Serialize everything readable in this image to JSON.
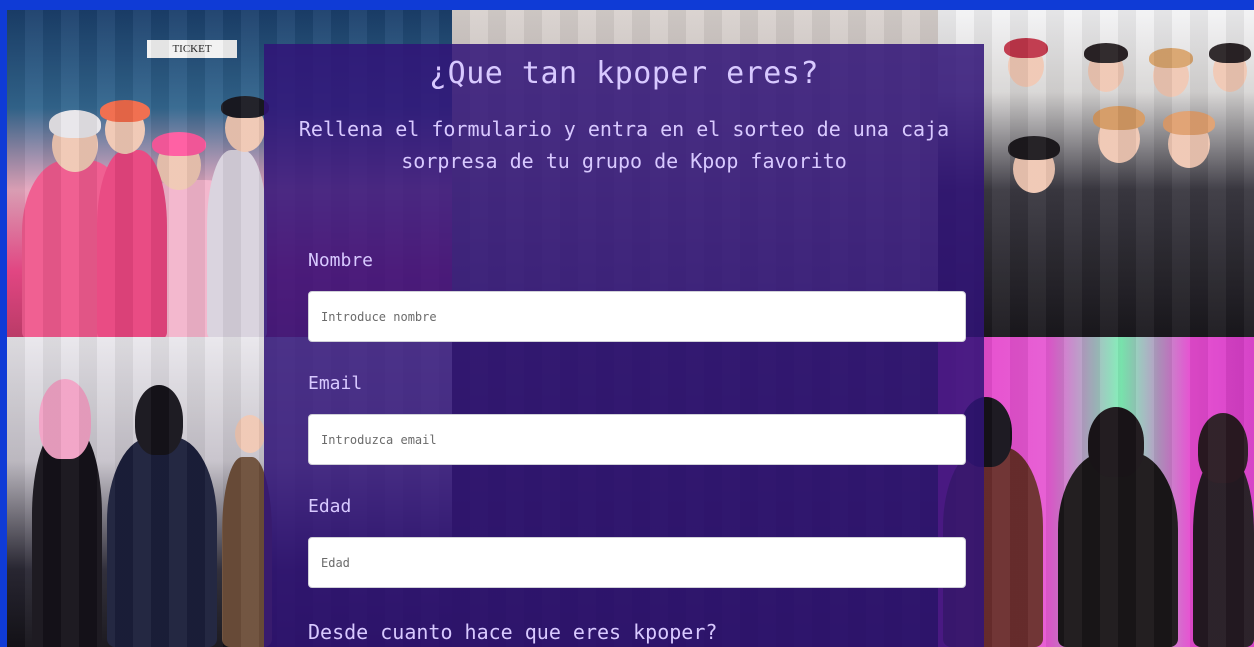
{
  "page": {
    "title": "¿Que tan kpoper eres?",
    "subtitle": "Rellena el formulario y entra en el sorteo de una caja sorpresa de tu grupo de Kpop favorito"
  },
  "form": {
    "name": {
      "label": "Nombre",
      "placeholder": "Introduce nombre",
      "value": ""
    },
    "email": {
      "label": "Email",
      "placeholder": "Introduzca email",
      "value": ""
    },
    "age": {
      "label": "Edad",
      "placeholder": "Edad",
      "value": ""
    },
    "since_question": "Desde cuanto hace que eres kpoper?"
  },
  "background": {
    "images": [
      "group-photo-pink",
      "group-photo-grey",
      "group-photo-boys",
      "group-photo-dresses",
      "group-photo-dark",
      "group-photo-stage"
    ]
  },
  "colors": {
    "accent_border": "#0f3bd6",
    "panel": "#311478",
    "text": "#d8c9ff"
  },
  "ticket_sign": "TICKET"
}
